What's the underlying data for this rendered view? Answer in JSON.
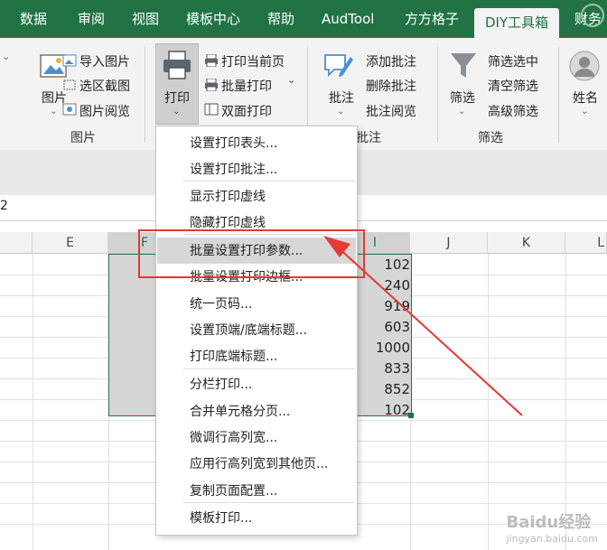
{
  "tabs": [
    "数据",
    "审阅",
    "视图",
    "模板中心",
    "帮助",
    "AudTool",
    "方方格子",
    "DIY工具箱",
    "财务"
  ],
  "active_tab": "DIY工具箱",
  "ribbon": {
    "image_group": {
      "big_label": "图片",
      "items": [
        "导入图片",
        "选区截图",
        "图片阅览"
      ],
      "group_label": "图片"
    },
    "print_group": {
      "big_label": "打印",
      "items": [
        "打印当前页",
        "批量打印",
        "双面打印"
      ]
    },
    "comment_group": {
      "big_label": "批注",
      "items": [
        "添加批注",
        "删除批注",
        "批注阅览"
      ],
      "group_label": "批注"
    },
    "filter_group": {
      "big_label": "筛选",
      "items": [
        "筛选选中",
        "清空筛选",
        "高级筛选"
      ],
      "group_label": "筛选"
    },
    "name_group": {
      "big_label": "姓名"
    }
  },
  "formula_bar": {
    "fragment": "2"
  },
  "columns": [
    "E",
    "F",
    "I",
    "J",
    "K",
    "L"
  ],
  "cell_values": [
    "102",
    "240",
    "919",
    "603",
    "1000",
    "833",
    "852",
    "102"
  ],
  "menu_items": [
    "设置打印表头...",
    "设置打印批注...",
    "显示打印虚线",
    "隐藏打印虚线",
    "批量设置打印参数...",
    "批量设置打印边框...",
    "统一页码...",
    "设置顶端/底端标题...",
    "打印底端标题...",
    "分栏打印...",
    "合并单元格分页...",
    "微调行高列宽...",
    "应用行高列宽到其他页...",
    "复制页面配置...",
    "模板打印..."
  ],
  "highlighted_item": "批量设置打印参数...",
  "colors": {
    "excel_green": "#217346",
    "annotation_red": "#e53935",
    "menu_highlight": "#d7d7d7"
  },
  "watermark": {
    "line1": "Baidu经验",
    "line2": "jingyan.baidu.com"
  }
}
